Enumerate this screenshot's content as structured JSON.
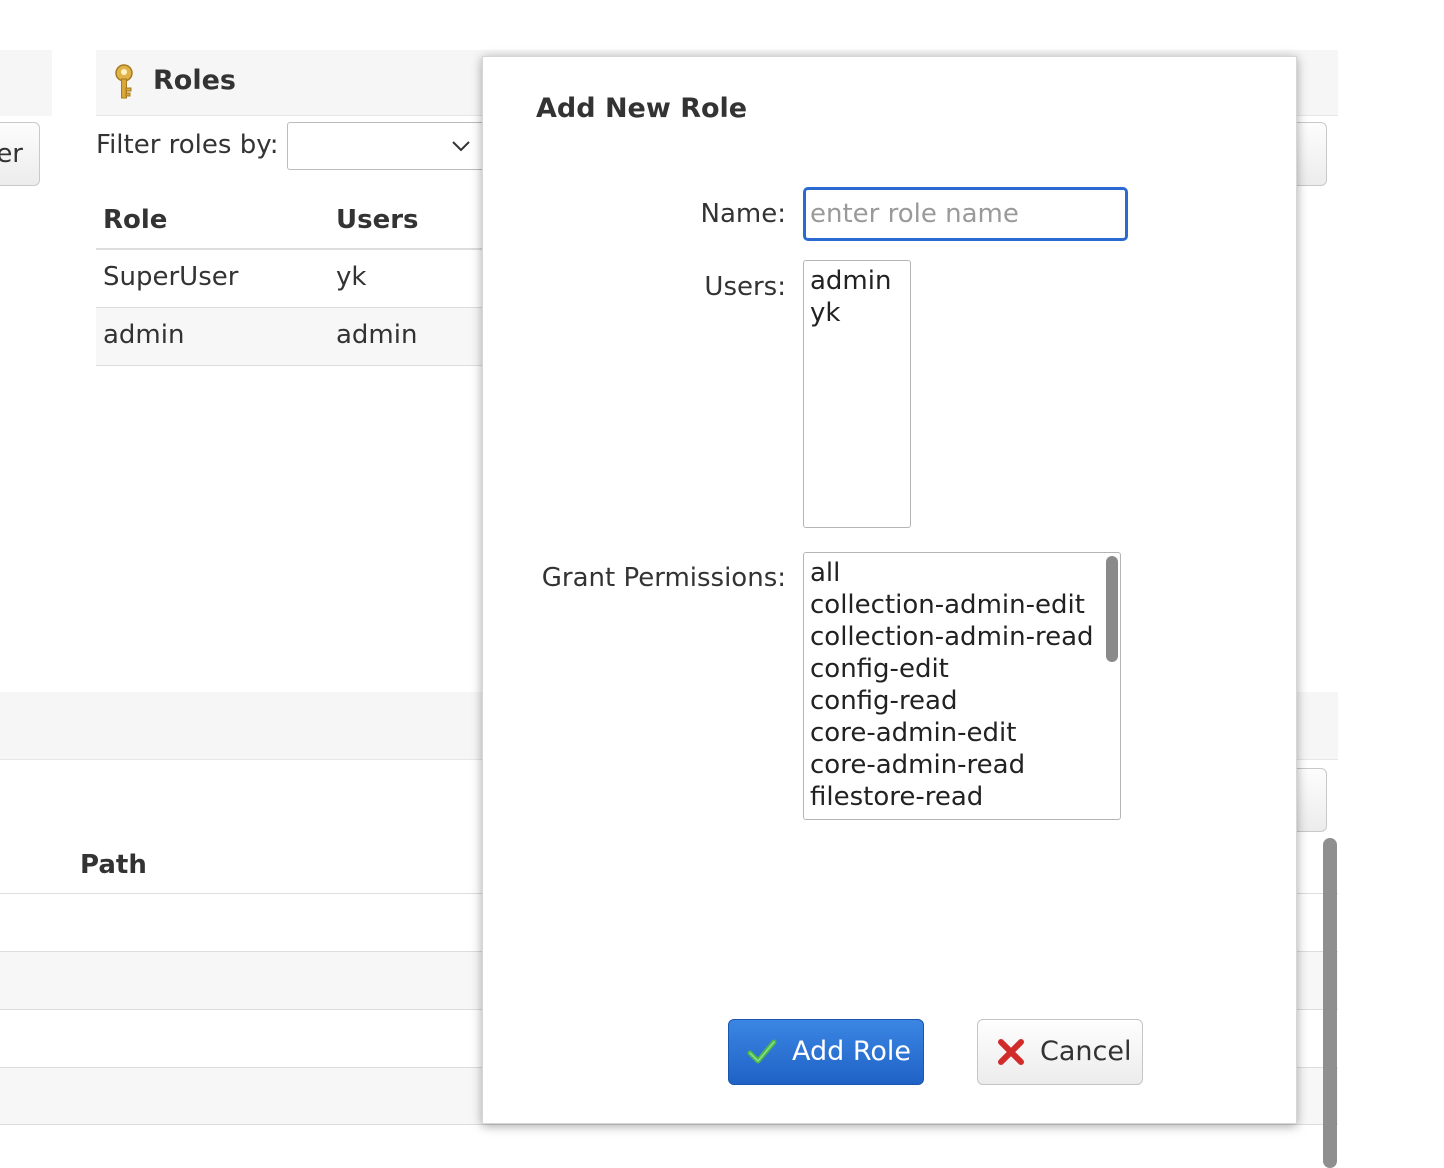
{
  "roles_panel": {
    "title": "Roles",
    "filter_label": "Filter roles by:",
    "filter_value": "",
    "columns": [
      "Role",
      "Users"
    ],
    "rows": [
      {
        "role": "SuperUser",
        "users": "yk"
      },
      {
        "role": "admin",
        "users": "admin"
      }
    ],
    "left_button_partial": "er"
  },
  "permissions_panel": {
    "path_header": "Path"
  },
  "modal": {
    "title": "Add New Role",
    "name_label": "Name:",
    "name_value": "",
    "name_placeholder": "enter role name",
    "users_label": "Users:",
    "users_options": [
      "admin",
      "yk"
    ],
    "permissions_label": "Grant Permissions:",
    "permission_options": [
      "all",
      "collection-admin-edit",
      "collection-admin-read",
      "config-edit",
      "config-read",
      "core-admin-edit",
      "core-admin-read",
      "filestore-read"
    ],
    "add_button": "Add Role",
    "cancel_button": "Cancel"
  },
  "colors": {
    "primary_button": "#2a6ad1",
    "cancel_icon": "#d22b2b",
    "check_icon": "#4cb84a",
    "header_bg": "#f6f6f6"
  },
  "icons": {
    "roles_header": "key-icon",
    "add_button": "check-icon",
    "cancel_button": "close-icon",
    "filter_select": "chevron-down-icon"
  }
}
